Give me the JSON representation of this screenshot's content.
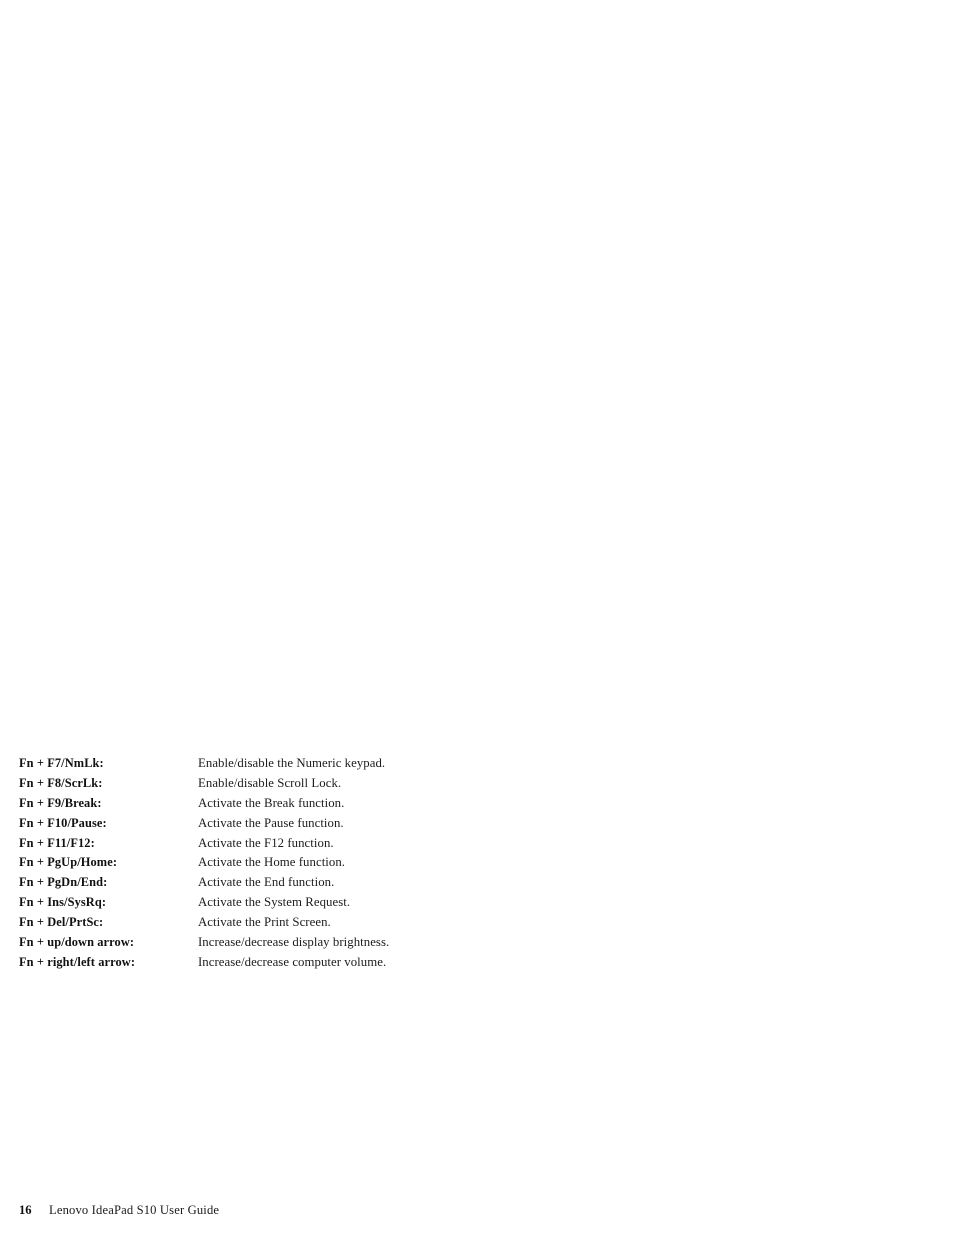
{
  "document": {
    "shortcuts": [
      {
        "key": "Fn + F7/NmLk:",
        "description": "Enable/disable the Numeric keypad."
      },
      {
        "key": "Fn + F8/ScrLk:",
        "description": "Enable/disable Scroll Lock."
      },
      {
        "key": "Fn + F9/Break:",
        "description": "Activate the Break function."
      },
      {
        "key": "Fn + F10/Pause:",
        "description": "Activate the Pause function."
      },
      {
        "key": "Fn + F11/F12:",
        "description": "Activate the F12 function."
      },
      {
        "key": "Fn + PgUp/Home:",
        "description": "Activate the Home function."
      },
      {
        "key": "Fn + PgDn/End:",
        "description": "Activate the End function."
      },
      {
        "key": "Fn + Ins/SysRq:",
        "description": "Activate the System Request."
      },
      {
        "key": "Fn + Del/PrtSc:",
        "description": "Activate the Print Screen."
      },
      {
        "key": "Fn + up/down arrow:",
        "description": "Increase/decrease display brightness."
      },
      {
        "key": "Fn + right/left arrow:",
        "description": "Increase/decrease computer volume."
      }
    ],
    "footer": {
      "page_number": "16",
      "title": "Lenovo IdeaPad S10 User Guide"
    }
  }
}
